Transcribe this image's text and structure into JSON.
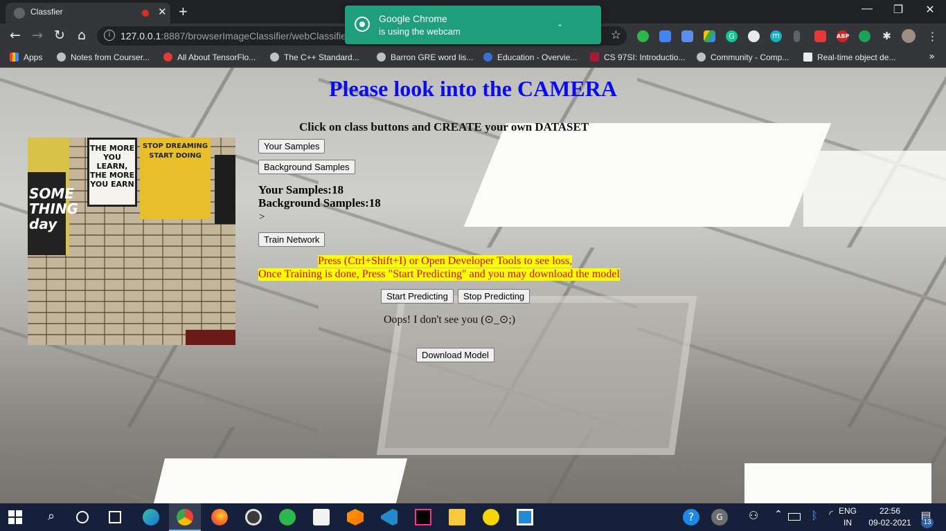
{
  "browser": {
    "tab_title": "Classfier",
    "tab_close": "✕",
    "new_tab": "+",
    "url_host": "127.0.0.1",
    "url_path": ":8887/browserImageClassifier/webClassifier.",
    "window_controls": {
      "minimize": "—",
      "restore": "❐",
      "close": "✕"
    },
    "nav": {
      "back": "←",
      "forward": "→",
      "reload": "↻",
      "home": "⌂"
    },
    "bookmarks": [
      {
        "label": "Apps"
      },
      {
        "label": "Notes from Courser..."
      },
      {
        "label": "All About TensorFlo..."
      },
      {
        "label": "The C++ Standard..."
      },
      {
        "label": "Barron GRE word lis..."
      },
      {
        "label": "Education - Overvie..."
      },
      {
        "label": "CS 97SI: Introductio..."
      },
      {
        "label": "Community - Comp..."
      },
      {
        "label": "Real-time object de..."
      }
    ],
    "bookmarks_more": "»",
    "extension_icons": [
      "evernote-icon",
      "docs-icon",
      "translate-icon",
      "drive-icon",
      "grammarly-icon",
      "speed-icon",
      "meet-icon",
      "pin-icon",
      "pdf-icon",
      "adblock-icon",
      "shield-icon",
      "puzzle-icon",
      "profile-icon",
      "menu-icon"
    ],
    "extension_labels": {
      "adblock": "ABP",
      "meet": "m",
      "grammarly": "G"
    }
  },
  "notification": {
    "line1": "Google Chrome",
    "line2": "is using the webcam"
  },
  "page": {
    "headline": "Please look into the CAMERA",
    "subheadline": "Click on class buttons and CREATE your own DATASET",
    "your_samples_button": "Your Samples",
    "background_samples_button": "Background Samples",
    "your_samples_count": "Your Samples:18",
    "background_samples_count": "Background Samples:18",
    "prompt": ">",
    "train_button": "Train Network",
    "instruction_line1": "Press (Ctrl+Shift+I) or Open Developer Tools to see loss,",
    "instruction_line2": "Once Training is done, Press \"Start Predicting\" and you may download the model",
    "start_button": "Start Predicting",
    "stop_button": "Stop Predicting",
    "status_message": "Oops! I don't see you (⊙_⊙;)",
    "download_button": "Download Model",
    "webcam_posters": [
      "THE MORE YOU LEARN, THE MORE YOU EARN",
      "STOP DREAMING START DOING",
      "SOME THING day"
    ]
  },
  "taskbar": {
    "apps": [
      "start-icon",
      "search-icon",
      "cortana-icon",
      "task-view-icon",
      "edge-icon",
      "chrome-icon",
      "firefox-icon",
      "media-icon",
      "evernote-icon",
      "store-icon",
      "tensorflow-icon",
      "vscode-icon",
      "intellij-icon",
      "explorer-icon",
      "emoji-app-icon",
      "sticky-icon"
    ],
    "lang_top": "ENG",
    "lang_bottom": "IN",
    "time": "22:56",
    "date": "09-02-2021",
    "notification_count": "13",
    "avatar_letter": "G",
    "colors": {
      "taskbar": "#17203a",
      "accent": "#76b9ed"
    }
  },
  "colors": {
    "headline": "#0b0bf0",
    "highlight_bg": "#ffff00",
    "highlight_text": "#e00000",
    "notification": "#1e9e7b"
  }
}
